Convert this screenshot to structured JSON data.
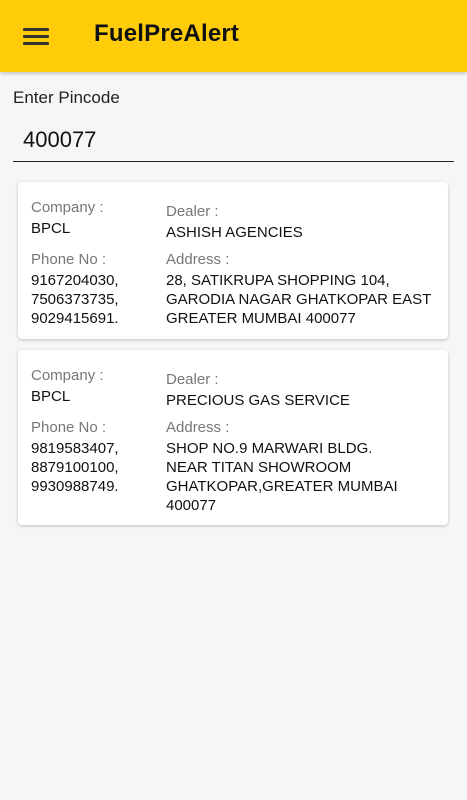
{
  "appbar": {
    "title": "FuelPreAlert",
    "menu_icon": "hamburger-menu-icon",
    "color": "#ffcc0a"
  },
  "search": {
    "label": "Enter Pincode",
    "value": "400077"
  },
  "results": [
    {
      "company_label": "Company :",
      "company": "BPCL",
      "dealer_label": "Dealer :",
      "dealer": "ASHISH AGENCIES",
      "phone_label": "Phone No :",
      "phones": [
        "9167204030,",
        "7506373735,",
        "9029415691."
      ],
      "address_label": "Address :",
      "address_lines": [
        "28, SATIKRUPA SHOPPING 104,",
        "GARODIA NAGAR GHATKOPAR EAST",
        "GREATER MUMBAI 400077"
      ]
    },
    {
      "company_label": "Company :",
      "company": "BPCL",
      "dealer_label": "Dealer :",
      "dealer": "PRECIOUS GAS SERVICE",
      "phone_label": "Phone No :",
      "phones": [
        "9819583407,",
        "8879100100,",
        "9930988749."
      ],
      "address_label": "Address :",
      "address_lines": [
        "SHOP NO.9 MARWARI BLDG.",
        "NEAR TITAN SHOWROOM",
        "GHATKOPAR,GREATER MUMBAI",
        "400077"
      ]
    }
  ]
}
